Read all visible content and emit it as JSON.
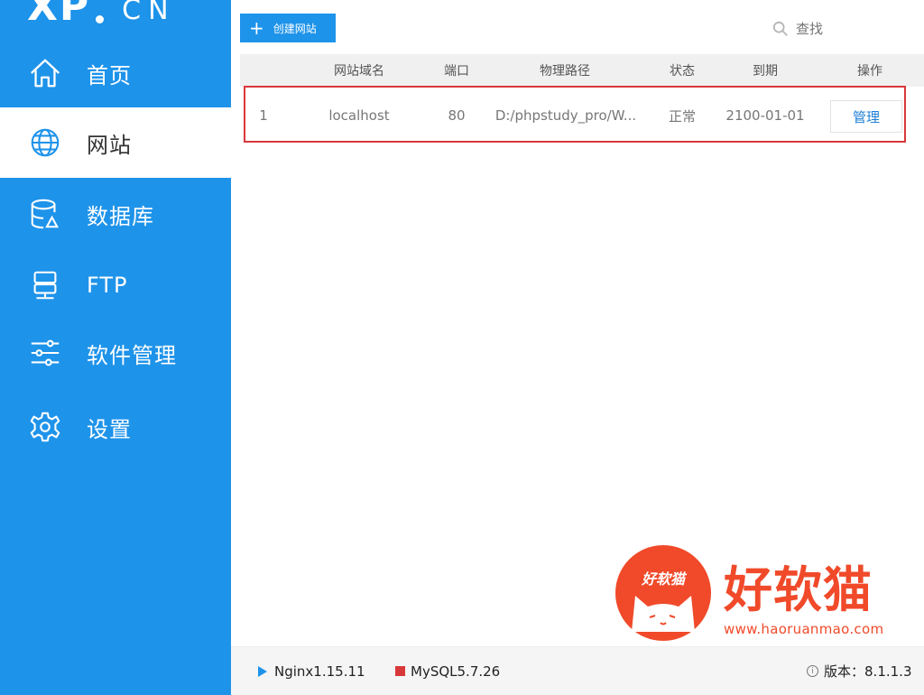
{
  "sidebar": {
    "logo_main": "XP",
    "logo_suffix": "CN",
    "items": [
      {
        "label": "首页",
        "icon": "home-icon"
      },
      {
        "label": "网站",
        "icon": "globe-icon"
      },
      {
        "label": "数据库",
        "icon": "database-icon"
      },
      {
        "label": "FTP",
        "icon": "ftp-server-icon"
      },
      {
        "label": "软件管理",
        "icon": "sliders-icon"
      },
      {
        "label": "设置",
        "icon": "gear-icon"
      }
    ],
    "active_index": 1
  },
  "toolbar": {
    "create_label": "创建网站",
    "search_placeholder": "查找"
  },
  "table": {
    "columns": [
      "网站域名",
      "端口",
      "物理路径",
      "状态",
      "到期",
      "操作"
    ],
    "rows": [
      {
        "index": "1",
        "domain": "localhost",
        "port": "80",
        "path": "D:/phpstudy_pro/W...",
        "status": "正常",
        "expiry": "2100-01-01",
        "action": "管理"
      }
    ]
  },
  "watermark": {
    "circle_text": "好软猫",
    "big_text": "好软猫",
    "url": "www.haoruanmao.com"
  },
  "statusbar": {
    "nginx": "Nginx1.15.11",
    "mysql": "MySQL5.7.26",
    "version_label": "版本：",
    "version": "8.1.1.3"
  },
  "colors": {
    "accent": "#1e93ea",
    "highlight_border": "#d9383a",
    "watermark": "#f04a2a"
  }
}
